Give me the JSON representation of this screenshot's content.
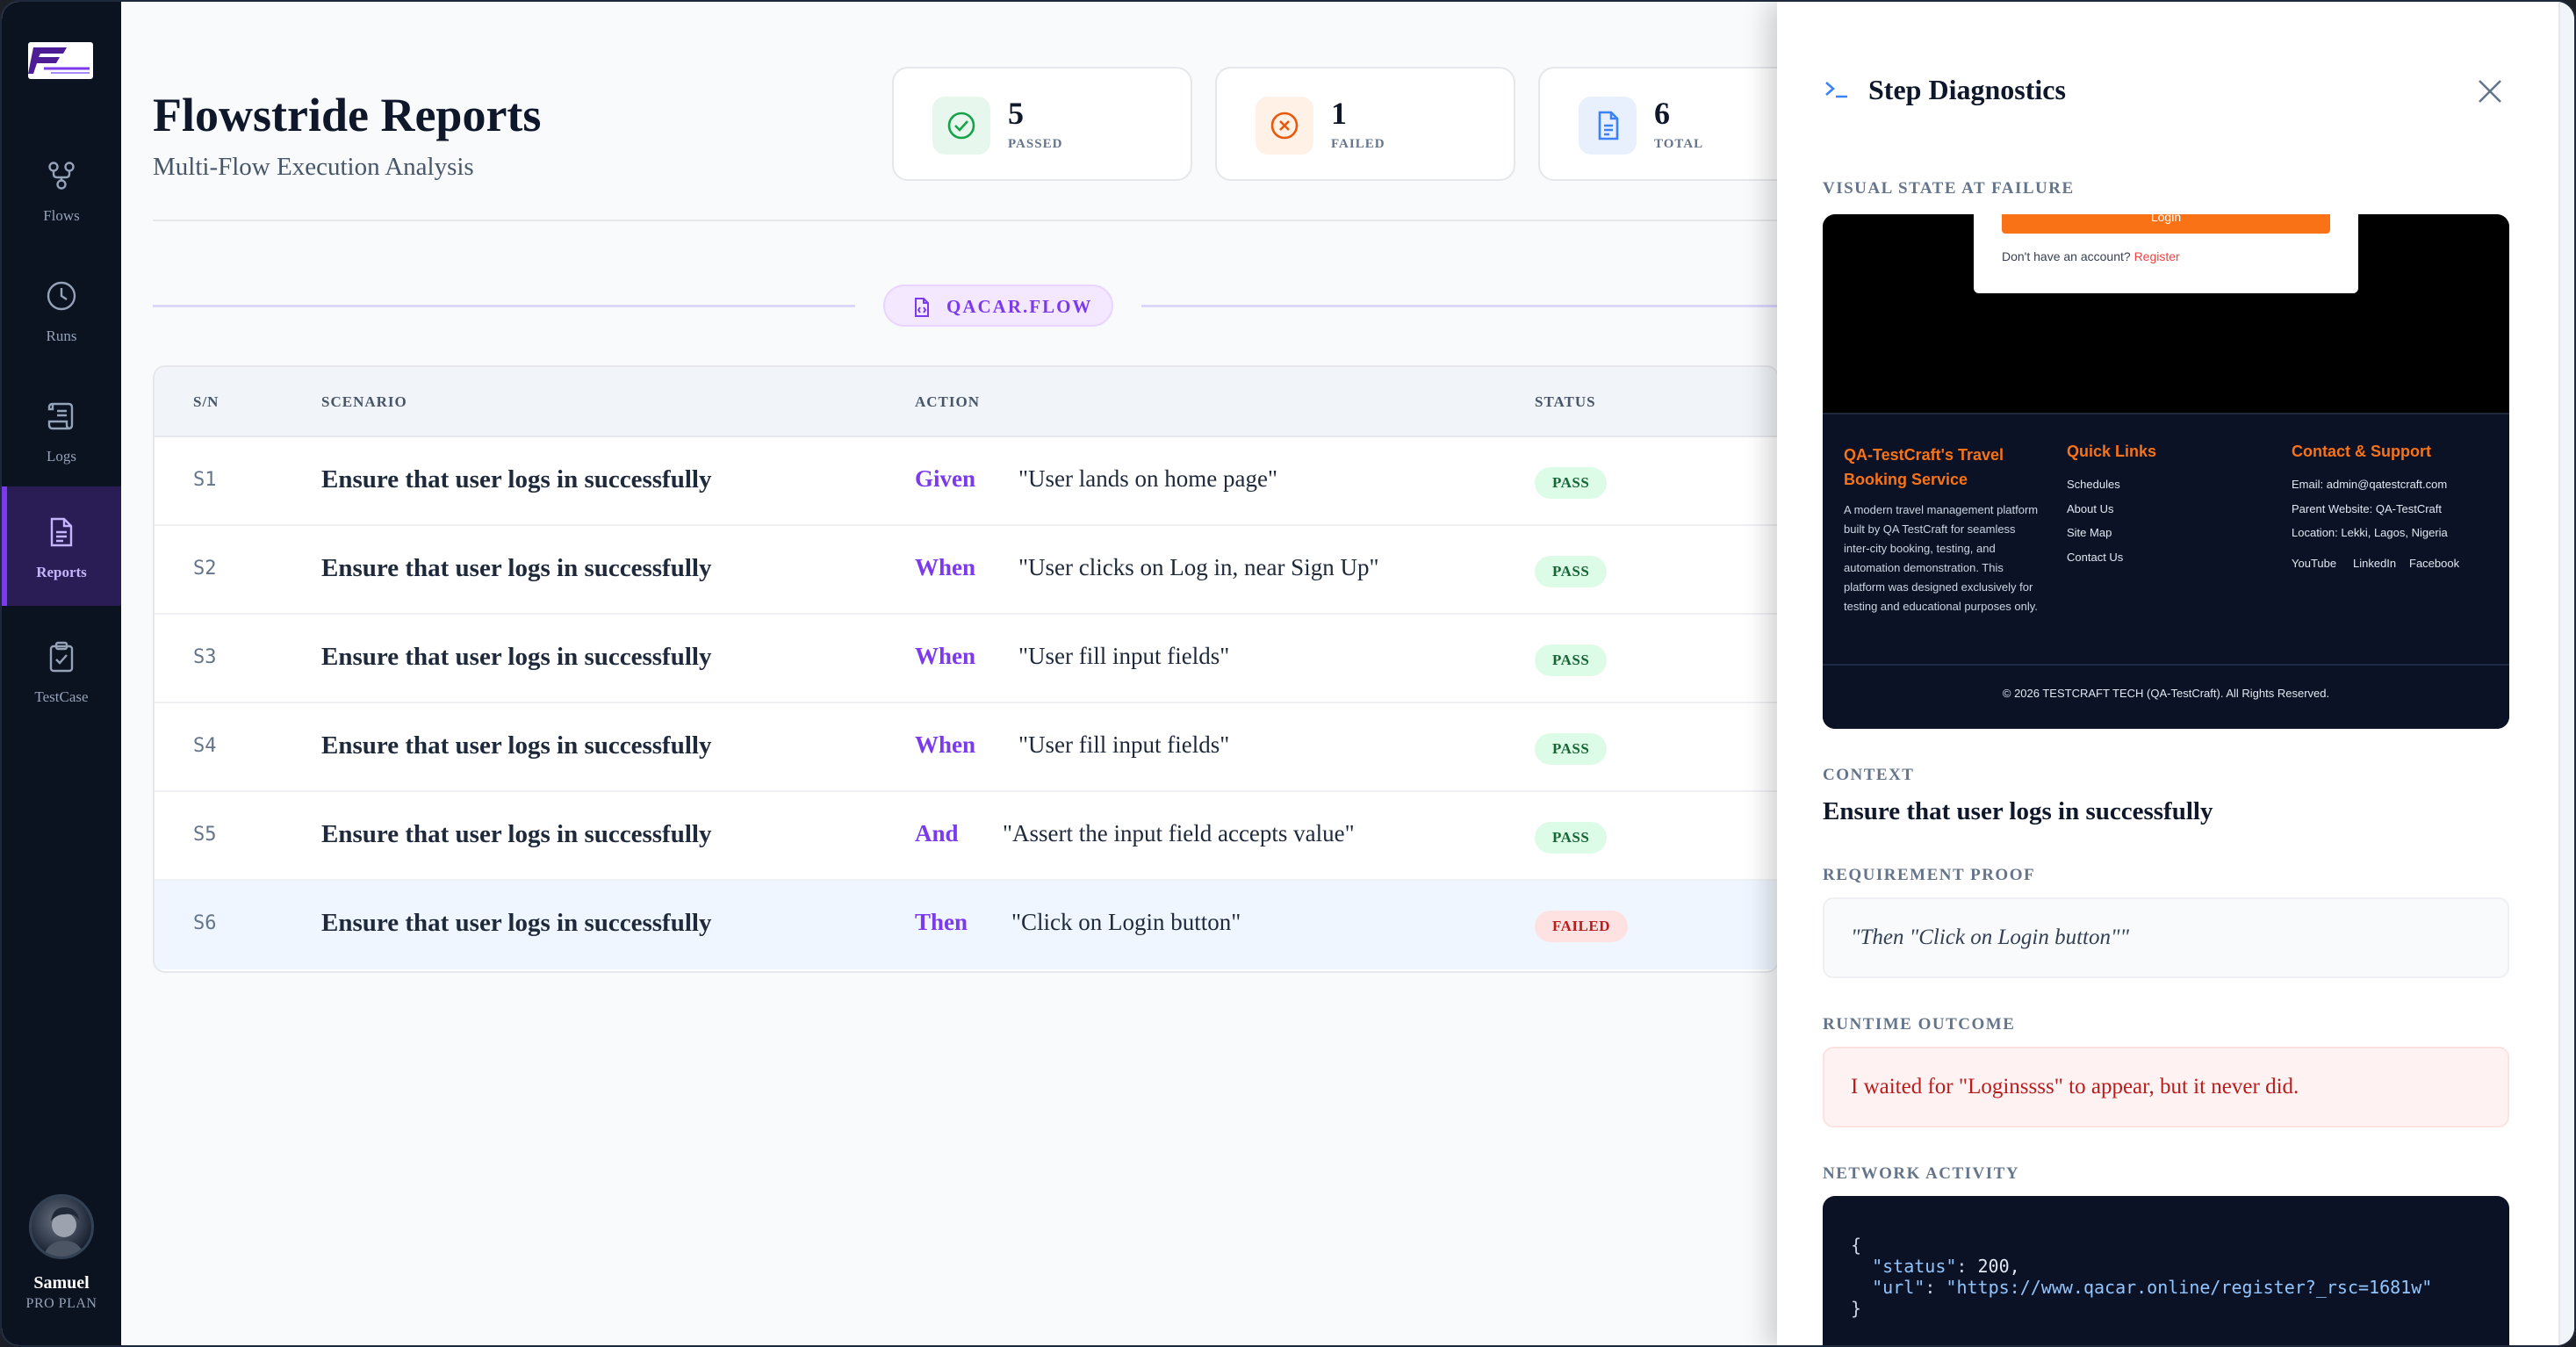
{
  "sidebar": {
    "nav": [
      {
        "label": "Flows",
        "icon": "flows-icon"
      },
      {
        "label": "Runs",
        "icon": "clock-icon"
      },
      {
        "label": "Logs",
        "icon": "scroll-icon"
      },
      {
        "label": "Reports",
        "icon": "document-icon",
        "active": true
      },
      {
        "label": "TestCase",
        "icon": "clipboard-check-icon"
      }
    ],
    "user": {
      "name": "Samuel",
      "plan": "PRO PLAN"
    }
  },
  "header": {
    "title": "Flowstride Reports",
    "subtitle": "Multi-Flow Execution Analysis"
  },
  "stats": [
    {
      "value": "5",
      "label": "PASSED",
      "color": "#16a34a",
      "bg": "#dcfce7"
    },
    {
      "value": "1",
      "label": "FAILED",
      "color": "#ea580c",
      "bg": "#ffedd5"
    },
    {
      "value": "6",
      "label": "TOTAL",
      "color": "#3b82f6",
      "bg": "#dbeafe"
    }
  ],
  "flow": {
    "name": "QACAR.FLOW"
  },
  "table": {
    "headers": {
      "sn": "S/N",
      "scenario": "SCENARIO",
      "action": "ACTION",
      "status": "STATUS"
    },
    "rows": [
      {
        "sn": "S1",
        "scenario": "Ensure that user logs in successfully",
        "keyword": "Given",
        "text": "\"User lands on home page\"",
        "status": "PASS"
      },
      {
        "sn": "S2",
        "scenario": "Ensure that user logs in successfully",
        "keyword": "When",
        "text": "\"User clicks on Log in, near Sign Up\"",
        "status": "PASS"
      },
      {
        "sn": "S3",
        "scenario": "Ensure that user logs in successfully",
        "keyword": "When",
        "text": "\"User fill input fields\"",
        "status": "PASS"
      },
      {
        "sn": "S4",
        "scenario": "Ensure that user logs in successfully",
        "keyword": "When",
        "text": "\"User fill input fields\"",
        "status": "PASS"
      },
      {
        "sn": "S5",
        "scenario": "Ensure that user logs in successfully",
        "keyword": "And",
        "text": "\"Assert the input field accepts value\"",
        "status": "PASS"
      },
      {
        "sn": "S6",
        "scenario": "Ensure that user logs in successfully",
        "keyword": "Then",
        "text": "\"Click on Login button\"",
        "status": "FAILED"
      }
    ]
  },
  "drawer": {
    "title": "Step Diagnostics",
    "visual_label": "VISUAL STATE AT FAILURE",
    "screenshot": {
      "login_button": "Login",
      "account_prompt": "Don't have an account?",
      "register_link": "Register",
      "col1_title": "QA-TestCraft's Travel Booking Service",
      "col1_text": "A modern travel management platform built by QA TestCraft for seamless inter-city booking, testing, and automation demonstration. This platform was designed exclusively for testing and educational purposes only.",
      "col2_title": "Quick Links",
      "col2_links": [
        "Schedules",
        "About Us",
        "Site Map",
        "Contact Us"
      ],
      "col3_title": "Contact & Support",
      "col3_lines": [
        "Email: admin@qatestcraft.com",
        "Parent Website: QA-TestCraft",
        "Location: Lekki, Lagos, Nigeria"
      ],
      "socials": [
        "YouTube",
        "LinkedIn",
        "Facebook"
      ],
      "copyright": "© 2026 TESTCRAFT TECH (QA-TestCraft). All Rights Reserved."
    },
    "context_label": "CONTEXT",
    "context_value": "Ensure that user logs in successfully",
    "proof_label": "REQUIREMENT PROOF",
    "proof_value": "\"Then \"Click on Login button\"\"",
    "outcome_label": "RUNTIME OUTCOME",
    "outcome_value": "I waited for \"Loginssss\" to appear, but it never did.",
    "network_label": "NETWORK ACTIVITY",
    "network": {
      "open": "{",
      "status_key": "\"status\"",
      "status_val": "200,",
      "url_key": "\"url\"",
      "url_val": "\"https://www.qacar.online/register?_rsc=1681w\"",
      "close": "}"
    }
  }
}
